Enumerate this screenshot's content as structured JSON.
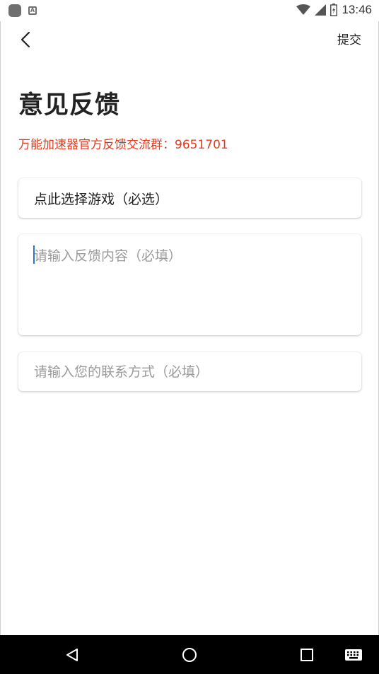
{
  "status_bar": {
    "time": "13:46",
    "left_icons": [
      "app-notification-icon",
      "a-notification-icon"
    ],
    "right_icons": [
      "wifi-icon",
      "cell-signal-icon",
      "battery-icon"
    ]
  },
  "header": {
    "back_icon": "chevron-left-icon",
    "submit_label": "提交"
  },
  "page": {
    "title": "意见反馈",
    "group_info": "万能加速器官方反馈交流群：9651701"
  },
  "form": {
    "game_select_label": "点此选择游戏（必选）",
    "feedback_placeholder": "请输入反馈内容（必填）",
    "contact_placeholder": "请输入您的联系方式（必填）"
  },
  "nav_bar": {
    "buttons": [
      "back-triangle-icon",
      "home-circle-icon",
      "recents-square-icon",
      "keyboard-icon"
    ]
  },
  "colors": {
    "accent_red": "#e23b1e",
    "caret_blue": "#2f78d0",
    "nav_background": "#000000"
  }
}
